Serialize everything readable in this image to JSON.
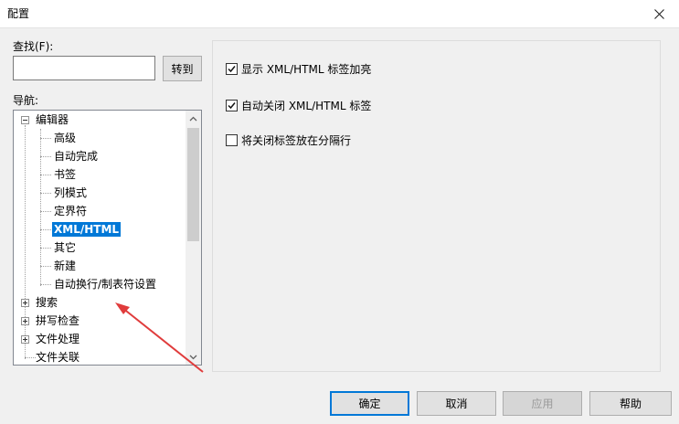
{
  "window": {
    "title": "配置"
  },
  "search": {
    "label": "查找(F):",
    "value": "",
    "goto_label": "转到"
  },
  "nav": {
    "label": "导航:",
    "items": [
      {
        "label": "编辑器",
        "level": 0,
        "expander": "minus"
      },
      {
        "label": "高级",
        "level": 1
      },
      {
        "label": "自动完成",
        "level": 1
      },
      {
        "label": "书签",
        "level": 1
      },
      {
        "label": "列模式",
        "level": 1
      },
      {
        "label": "定界符",
        "level": 1
      },
      {
        "label": "XML/HTML",
        "level": 1,
        "selected": true
      },
      {
        "label": "其它",
        "level": 1
      },
      {
        "label": "新建",
        "level": 1
      },
      {
        "label": "自动换行/制表符设置",
        "level": 1
      },
      {
        "label": "搜索",
        "level": 0,
        "expander": "plus"
      },
      {
        "label": "拼写检查",
        "level": 0,
        "expander": "plus"
      },
      {
        "label": "文件处理",
        "level": 0,
        "expander": "plus"
      },
      {
        "label": "文件关联",
        "level": 0
      }
    ]
  },
  "options": [
    {
      "label": "显示 XML/HTML 标签加亮",
      "checked": true
    },
    {
      "label": "自动关闭 XML/HTML 标签",
      "checked": true
    },
    {
      "label": "将关闭标签放在分隔行",
      "checked": false
    }
  ],
  "buttons": {
    "ok": "确定",
    "cancel": "取消",
    "apply": "应用",
    "help": "帮助"
  },
  "colors": {
    "selection": "#0078d7",
    "arrow": "#e03c3c"
  }
}
